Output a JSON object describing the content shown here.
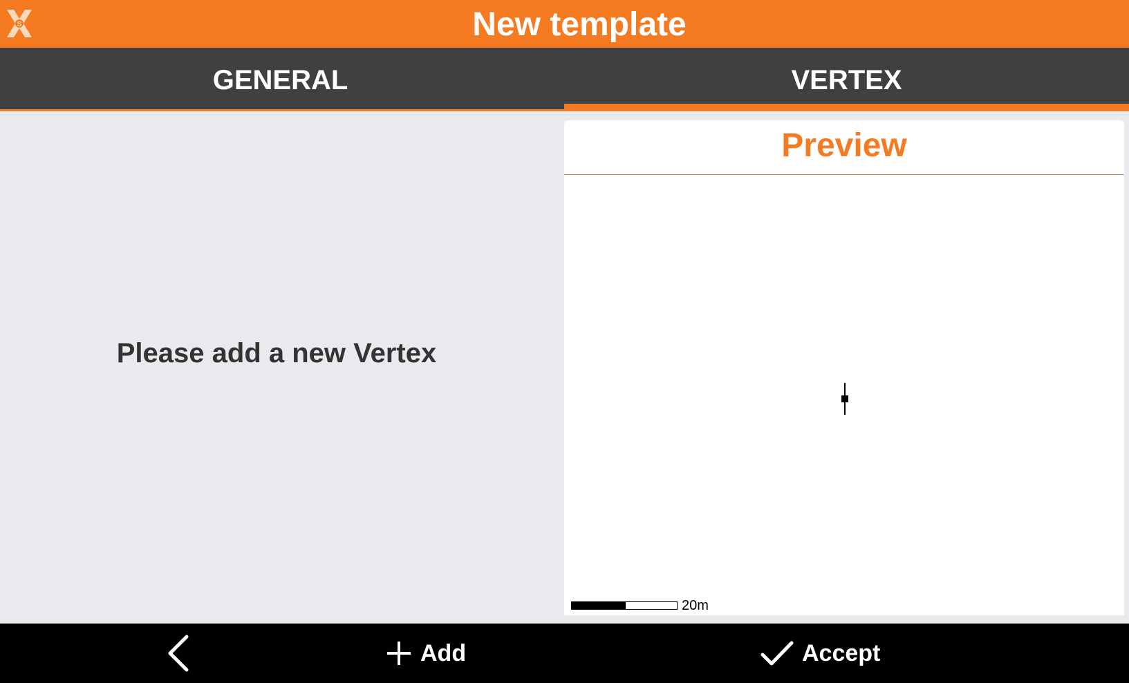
{
  "app": {
    "title": "New template",
    "logo_icon": "app-logo-icon",
    "accent_color": "#f47b22"
  },
  "tabs": [
    {
      "label": "GENERAL",
      "selected": false
    },
    {
      "label": "VERTEX",
      "selected": true
    }
  ],
  "left_pane": {
    "empty_message": "Please add a new Vertex"
  },
  "preview": {
    "title": "Preview",
    "scale_label": "20m"
  },
  "bottom_bar": {
    "back_icon": "chevron-left-icon",
    "add_label": "Add",
    "add_icon": "plus-icon",
    "accept_label": "Accept",
    "accept_icon": "check-icon"
  }
}
